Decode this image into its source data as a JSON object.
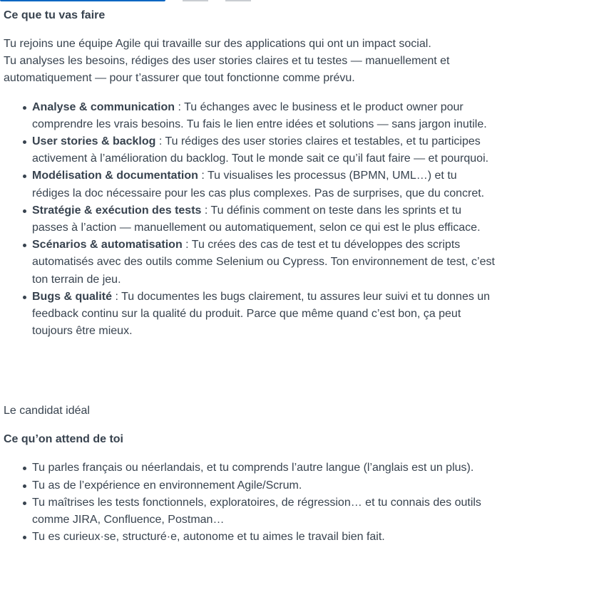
{
  "section1": {
    "heading": "Ce que tu vas faire",
    "intro": [
      "Tu rejoins une équipe Agile qui travaille sur des applications qui ont un impact social.",
      "Tu analyses les besoins, rédiges des user stories claires et tu testes — manuellement et automatiquement — pour t’assurer que tout fonctionne comme prévu."
    ],
    "items": [
      {
        "title": "Analyse & communication",
        "text": " : Tu échanges avec le business et le product owner pour comprendre les vrais besoins. Tu fais le lien entre idées et solutions — sans jargon inutile."
      },
      {
        "title": "User stories & backlog",
        "text": " : Tu rédiges des user stories claires et testables, et tu participes activement à l’amélioration du backlog. Tout le monde sait ce qu’il faut faire — et pourquoi."
      },
      {
        "title": "Modélisation & documentation",
        "text": " : Tu visualises les processus (BPMN, UML…) et tu rédiges la doc nécessaire pour les cas plus complexes. Pas de surprises, que du concret."
      },
      {
        "title": "Stratégie & exécution des tests",
        "text": " : Tu définis comment on teste dans les sprints et tu passes à l’action — manuellement ou automatiquement, selon ce qui est le plus efficace."
      },
      {
        "title": "Scénarios & automatisation",
        "text": " : Tu crées des cas de test et tu développes des scripts automatisés avec des outils comme Selenium ou Cypress. Ton environnement de test, c’est ton terrain de jeu."
      },
      {
        "title": "Bugs & qualité",
        "text": " : Tu documentes les bugs clairement, tu assures leur suivi et tu donnes un feedback continu sur la qualité du produit. Parce que même quand c’est bon, ça peut toujours être mieux."
      }
    ]
  },
  "section2": {
    "label": "Le candidat idéal",
    "heading": "Ce qu’on attend de toi",
    "items": [
      "Tu parles français ou néerlandais, et tu comprends l’autre langue (l’anglais est un plus).",
      "Tu as de l’expérience en environnement Agile/Scrum.",
      "Tu maîtrises les tests fonctionnels, exploratoires, de régression… et tu connais des outils comme JIRA, Confluence, Postman…",
      "Tu es curieux·se, structuré·e, autonome et tu aimes le travail bien fait."
    ]
  },
  "colors": {
    "text": "#38434f",
    "accent": "#0a66c2",
    "muted": "#c9cdd1"
  }
}
